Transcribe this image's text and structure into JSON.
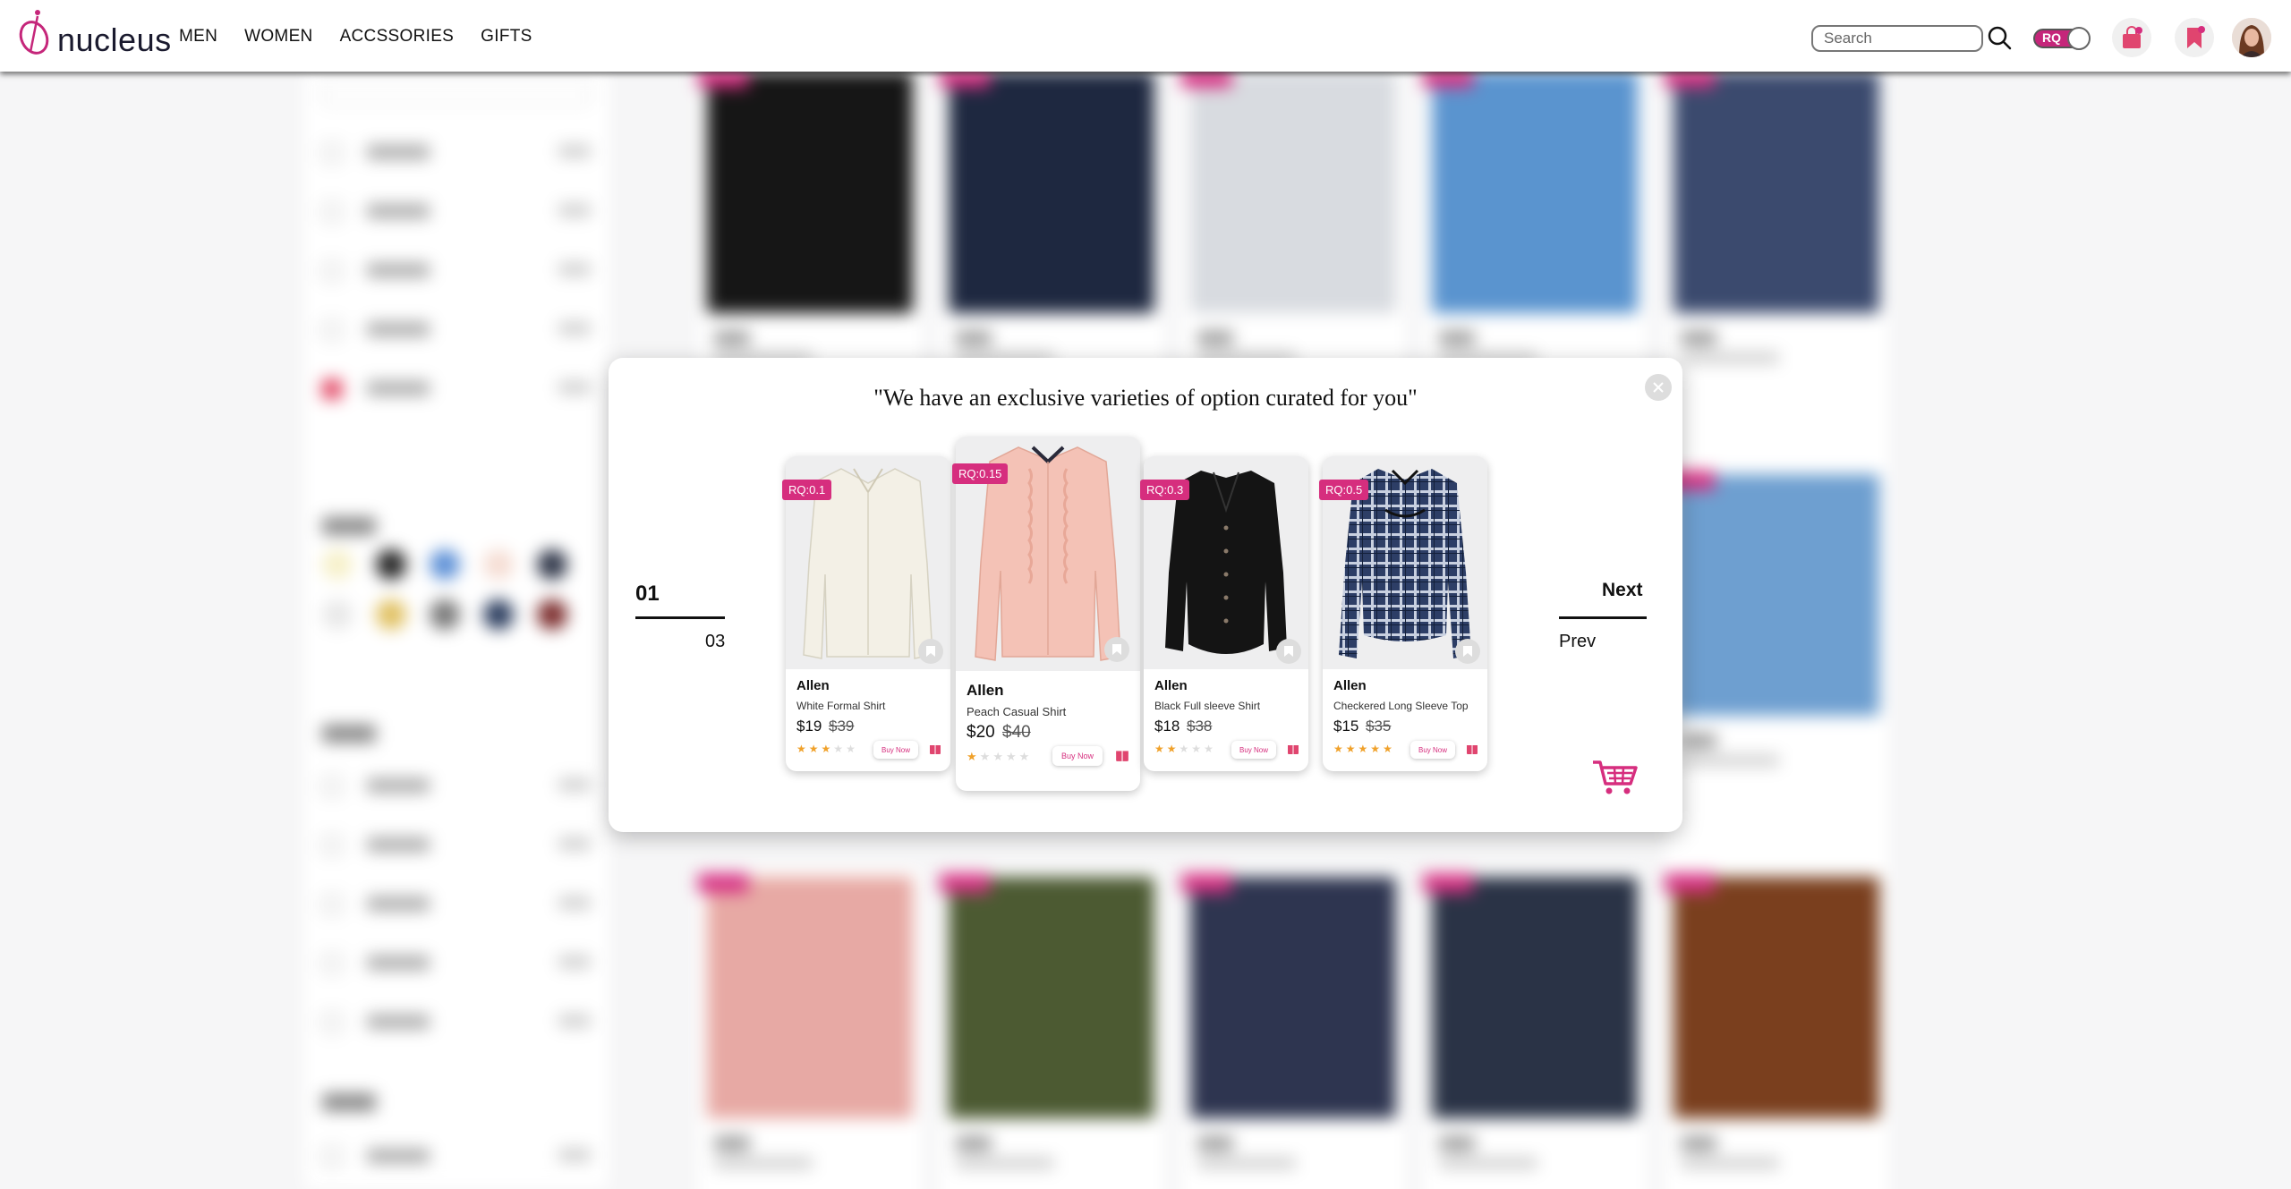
{
  "header": {
    "brand": "nucleus",
    "nav": [
      "MEN",
      "WOMEN",
      "ACCSSORIES",
      "GIFTS"
    ],
    "search_placeholder": "Search",
    "rq_toggle_label": "RQ"
  },
  "colors": {
    "accent": "#d62e7e",
    "rating_star": "#f0a12a",
    "text": "#111111"
  },
  "modal": {
    "title": "\"We have an exclusive varieties of option curated for you\"",
    "page_current": "01",
    "page_total": "03",
    "next_label": "Next",
    "prev_label": "Prev",
    "products": [
      {
        "rq": "RQ:0.1",
        "brand": "Allen",
        "name": "White Formal Shirt",
        "price": "$19",
        "old_price": "$39",
        "rating": 3,
        "buy_label": "Buy Now"
      },
      {
        "rq": "RQ:0.15",
        "brand": "Allen",
        "name": "Peach Casual Shirt",
        "price": "$20",
        "old_price": "$40",
        "rating": 1,
        "buy_label": "Buy Now"
      },
      {
        "rq": "RQ:0.3",
        "brand": "Allen",
        "name": "Black Full sleeve Shirt",
        "price": "$18",
        "old_price": "$38",
        "rating": 2,
        "buy_label": "Buy Now"
      },
      {
        "rq": "RQ:0.5",
        "brand": "Allen",
        "name": "Checkered Long Sleeve Top",
        "price": "$15",
        "old_price": "$35",
        "rating": 5,
        "buy_label": "Buy Now"
      }
    ]
  }
}
